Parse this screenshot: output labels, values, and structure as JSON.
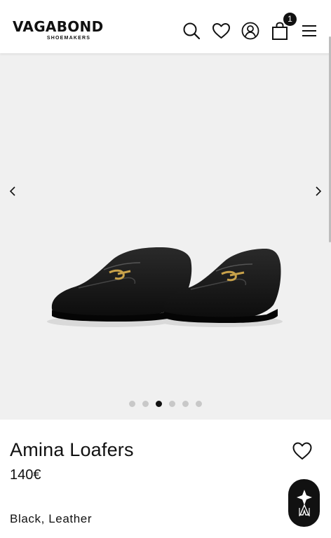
{
  "header": {
    "brand": "VAGABOND",
    "brand_sub": "SHOEMAKERS",
    "cart_count": "1",
    "icons": [
      "search-icon",
      "heart-icon",
      "user-icon",
      "bag-icon",
      "menu-icon"
    ]
  },
  "gallery": {
    "slide_count": 6,
    "active_slide": 3
  },
  "product": {
    "name": "Amina Loafers",
    "price": "140€",
    "color_material": "Black, Leather"
  },
  "colors": {
    "accent": "#111111",
    "gallery_bg": "#f0f0f0",
    "dot_inactive": "#c8c8c8"
  }
}
